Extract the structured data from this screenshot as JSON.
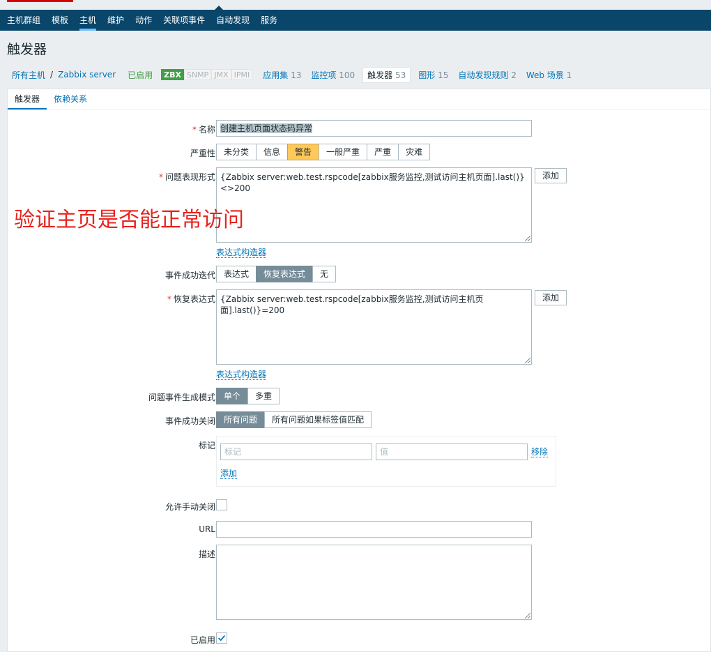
{
  "topnav": {
    "items": [
      "主机群组",
      "模板",
      "主机",
      "维护",
      "动作",
      "关联项事件",
      "自动发现",
      "服务"
    ],
    "active_index": 2
  },
  "page_title": "触发器",
  "breadcrumb": {
    "all_hosts": "所有主机",
    "separator": "/",
    "host": "Zabbix server",
    "status": "已启用",
    "availability": [
      "ZBX",
      "SNMP",
      "JMX",
      "IPMI"
    ],
    "tabs": [
      {
        "label": "应用集",
        "count": "13"
      },
      {
        "label": "监控项",
        "count": "100"
      },
      {
        "label": "触发器",
        "count": "53"
      },
      {
        "label": "图形",
        "count": "15"
      },
      {
        "label": "自动发现规则",
        "count": "2"
      },
      {
        "label": "Web 场景",
        "count": "1"
      }
    ]
  },
  "subtabs": [
    "触发器",
    "依赖关系"
  ],
  "form": {
    "name_label": "名称",
    "name_value": "创建主机页面状态码异常",
    "severity_label": "严重性",
    "severity_options": [
      "未分类",
      "信息",
      "警告",
      "一般严重",
      "严重",
      "灾难"
    ],
    "severity_selected": "警告",
    "problem_expr_label": "问题表现形式",
    "problem_expr_value": "{Zabbix server:web.test.rspcode[zabbix服务监控,测试访问主机页面].last()}<>200",
    "add_button": "添加",
    "expr_builder": "表达式构造器",
    "ok_event_label": "事件成功迭代",
    "ok_event_options": [
      "表达式",
      "恢复表达式",
      "无"
    ],
    "ok_event_selected": "恢复表达式",
    "recovery_expr_label": "恢复表达式",
    "recovery_expr_value": "{Zabbix server:web.test.rspcode[zabbix服务监控,测试访问主机页面].last()}=200",
    "gen_mode_label": "问题事件生成模式",
    "gen_mode_options": [
      "单个",
      "多重"
    ],
    "gen_mode_selected": "单个",
    "ok_close_label": "事件成功关闭",
    "ok_close_options": [
      "所有问题",
      "所有问题如果标签值匹配"
    ],
    "ok_close_selected": "所有问题",
    "tags_label": "标记",
    "tag_placeholder": "标记",
    "value_placeholder": "值",
    "remove_link": "移除",
    "add_link": "添加",
    "manual_close_label": "允许手动关闭",
    "manual_close_checked": false,
    "url_label": "URL",
    "url_value": "",
    "desc_label": "描述",
    "desc_value": "",
    "enabled_label": "已启用",
    "enabled_checked": true
  },
  "annotation": "验证主页是否能正常访问",
  "colors": {
    "nav_bg": "#0a466a",
    "link": "#0275b8",
    "warning": "#ffc859",
    "selected_grey": "#768d99",
    "enabled_green": "#429e47",
    "annotation_red": "#e8231d"
  }
}
